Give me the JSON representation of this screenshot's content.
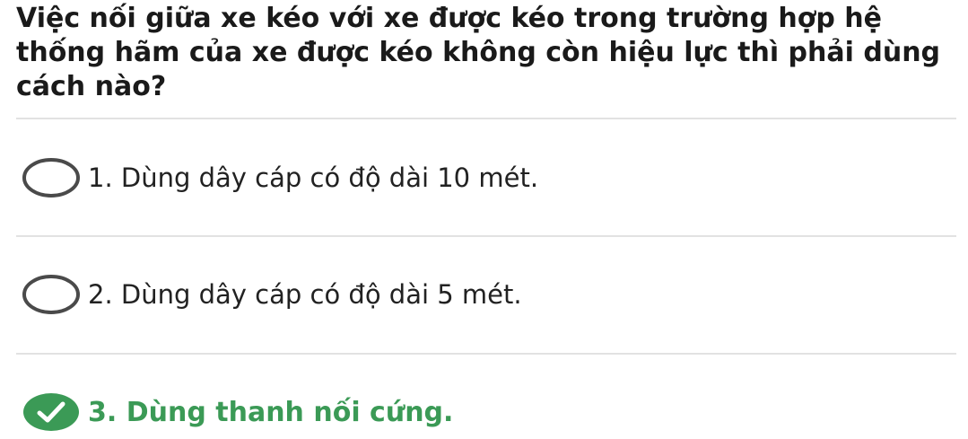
{
  "question": {
    "text": "Việc nối giữa xe kéo với xe được kéo trong trường hợp hệ thống hãm của xe được kéo không còn hiệu lực thì phải dùng cách nào?"
  },
  "options": [
    {
      "label": "1. Dùng dây cáp có độ dài 10 mét.",
      "state": "unselected",
      "icon": "radio-empty-icon"
    },
    {
      "label": "2. Dùng dây cáp có độ dài 5 mét.",
      "state": "unselected",
      "icon": "radio-empty-icon"
    },
    {
      "label": "3. Dùng thanh nối cứng.",
      "state": "correct",
      "icon": "checkmark-icon"
    }
  ],
  "colors": {
    "text": "#1a1a1a",
    "correct": "#3b9a56",
    "radio_border": "#4a4a4a",
    "divider": "#e2e2e2"
  }
}
